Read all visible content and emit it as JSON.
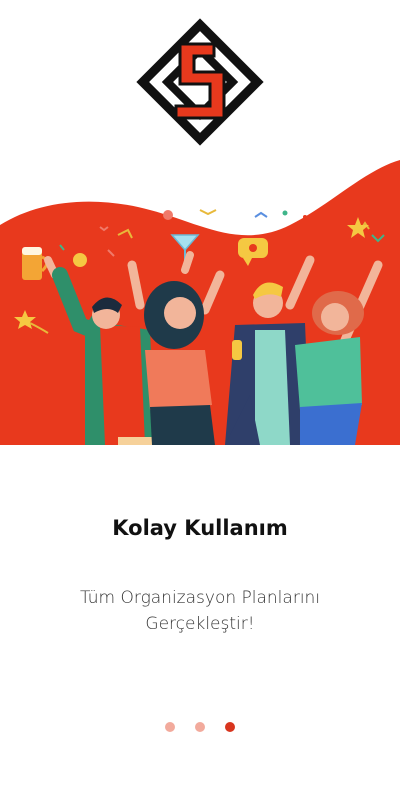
{
  "brand": {
    "logo_icon": "diamond-s-logo-icon",
    "accent_color": "#e8391d"
  },
  "hero": {
    "image_icon": "party-people-illustration"
  },
  "onboarding": {
    "title": "Kolay Kullanım",
    "subtitle": "Tüm Organizasyon Planlarını Gerçekleştir!"
  },
  "pagination": {
    "total": 3,
    "active_index": 2,
    "active_color": "#d8351e",
    "inactive_color": "#f2aa9c"
  }
}
